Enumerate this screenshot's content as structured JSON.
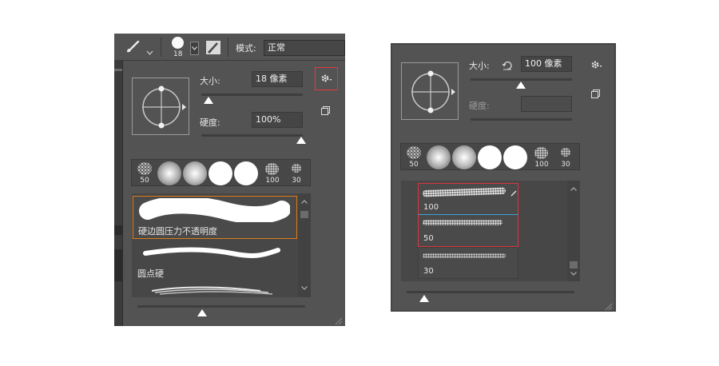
{
  "left": {
    "toolbar": {
      "brush_size_value": "18",
      "mode_label": "模式:",
      "mode_value": "正常"
    },
    "size_label": "大小:",
    "size_value": "18 像素",
    "hardness_label": "硬度:",
    "hardness_value": "100%",
    "tips": [
      {
        "label": "50"
      },
      {
        "label": ""
      },
      {
        "label": ""
      },
      {
        "label": ""
      },
      {
        "label": ""
      },
      {
        "label": "100"
      },
      {
        "label": "30"
      }
    ],
    "brushes": [
      {
        "name": "硬边圆压力不透明度",
        "selected": true
      },
      {
        "name": "圆点硬",
        "selected": false
      }
    ],
    "icons": [
      "brush-icon",
      "chevron-down-icon",
      "gear-icon",
      "new-preset-icon"
    ],
    "accent": "#e07b1a",
    "highlight": "#e8383d"
  },
  "right": {
    "size_label": "大小:",
    "size_value": "100 像素",
    "hardness_label": "硬度:",
    "hardness_value": "",
    "tips": [
      {
        "label": "50"
      },
      {
        "label": ""
      },
      {
        "label": ""
      },
      {
        "label": ""
      },
      {
        "label": ""
      },
      {
        "label": "100"
      },
      {
        "label": "30"
      }
    ],
    "brushes": [
      {
        "label": "100",
        "selected": true
      },
      {
        "label": "50",
        "selected": true
      },
      {
        "label": "30",
        "selected": false
      }
    ],
    "icons": [
      "reset-icon",
      "gear-icon",
      "new-preset-icon"
    ],
    "highlight": "#d9363e"
  }
}
